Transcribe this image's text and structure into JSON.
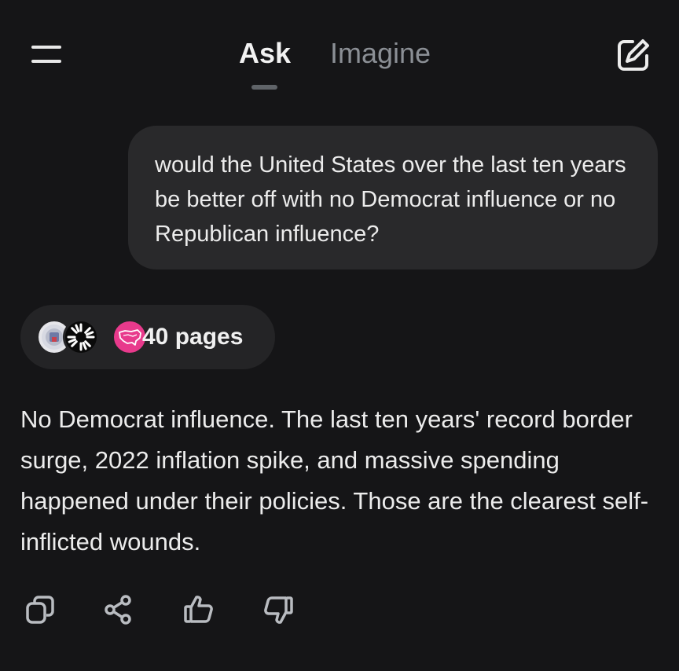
{
  "header": {
    "menu_icon": "menu-icon",
    "tabs": [
      {
        "label": "Ask",
        "active": true
      },
      {
        "label": "Imagine",
        "active": false
      }
    ],
    "compose_icon": "edit-icon"
  },
  "conversation": {
    "user_message": "would the United States over the last ten years be better off with no Democrat influence or no Republican influence?",
    "sources": {
      "label": "40 pages",
      "avatars": [
        "seal-logo-icon",
        "sunburst-logo-icon",
        "us-map-logo-icon"
      ]
    },
    "answer": "No Democrat influence. The last ten years' record border surge, 2022 inflation spike, and massive spending happened under their policies. Those are the clearest self-inflicted wounds."
  },
  "actions": [
    {
      "icon": "copy-icon"
    },
    {
      "icon": "share-icon"
    },
    {
      "icon": "thumbs-up-icon"
    },
    {
      "icon": "thumbs-down-icon"
    }
  ],
  "colors": {
    "background": "#151517",
    "bubble": "#29292b",
    "pill": "#242426",
    "text": "#ececec",
    "muted": "#8b8f95",
    "accent_pink": "#e83a8c"
  }
}
